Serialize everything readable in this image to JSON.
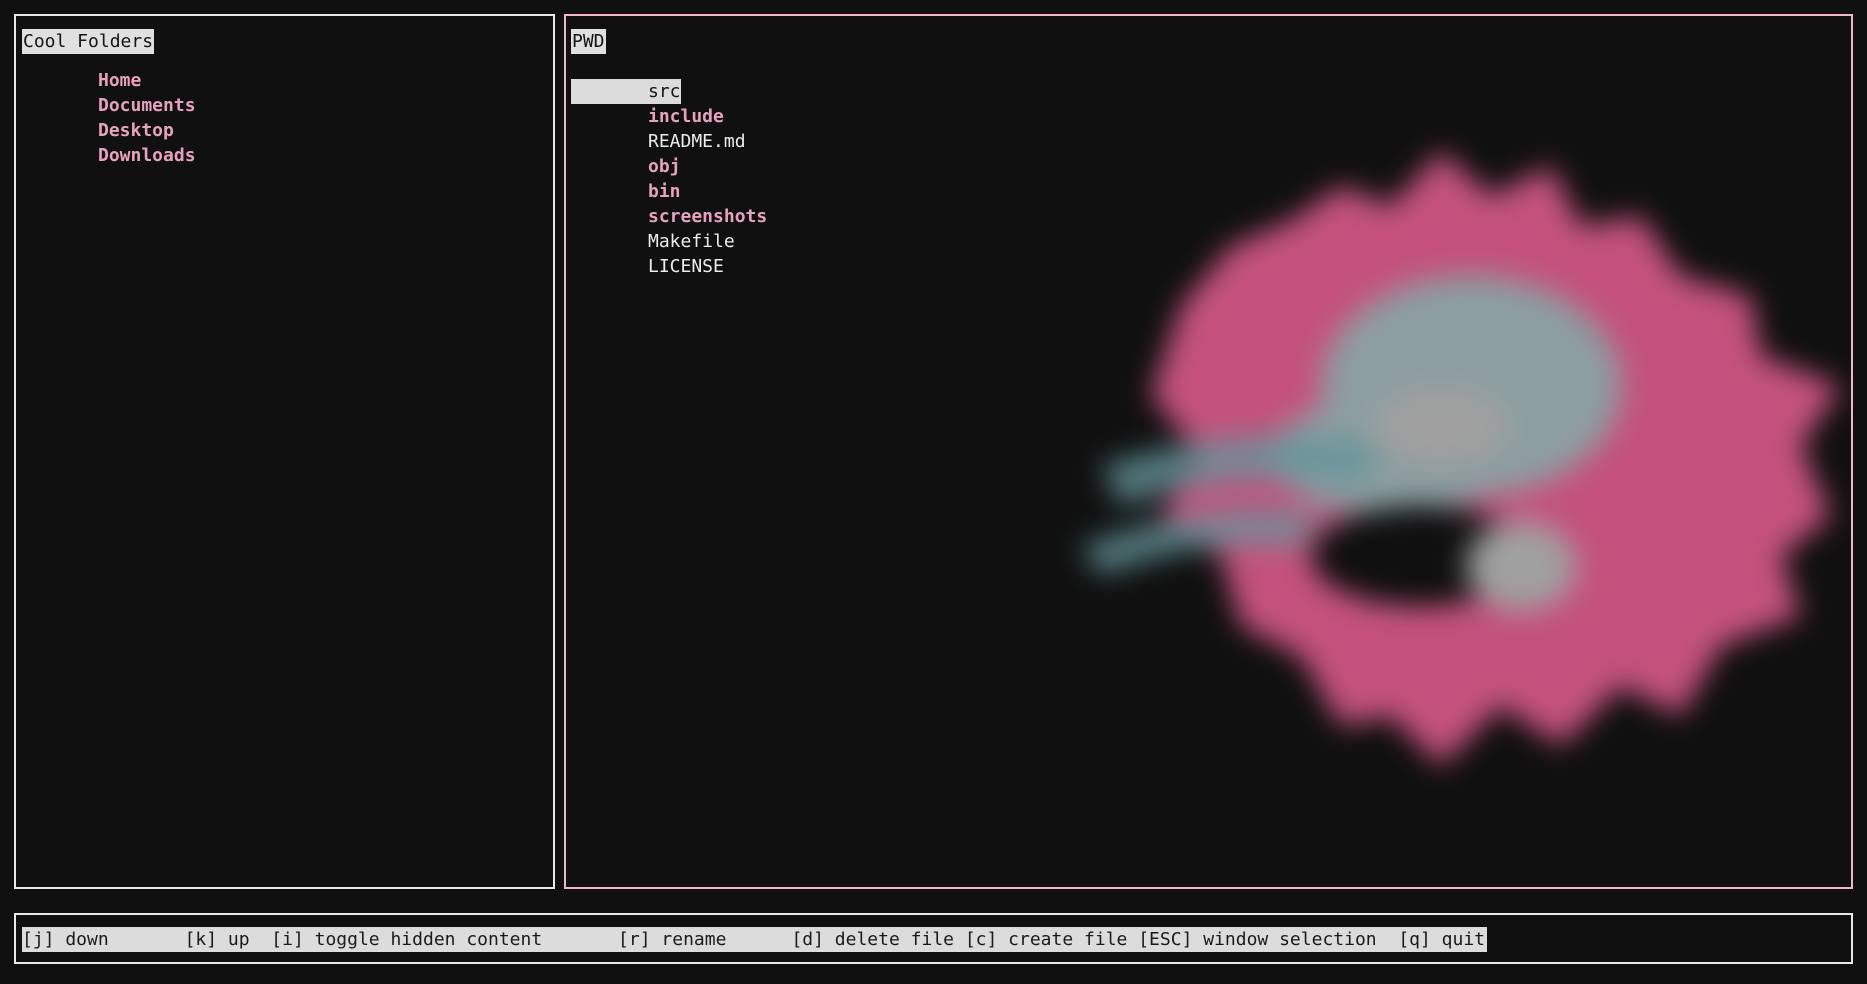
{
  "left_pane": {
    "title": "Cool Folders",
    "items": [
      "Home",
      "Documents",
      "Desktop",
      "Downloads"
    ]
  },
  "right_pane": {
    "title": "PWD",
    "entries": [
      {
        "name": "src",
        "type": "dir",
        "selected": true
      },
      {
        "name": "include",
        "type": "dir"
      },
      {
        "name": "README.md",
        "type": "file"
      },
      {
        "name": "obj",
        "type": "dir"
      },
      {
        "name": "bin",
        "type": "dir"
      },
      {
        "name": "screenshots",
        "type": "dir"
      },
      {
        "name": "Makefile",
        "type": "file"
      },
      {
        "name": "LICENSE",
        "type": "file"
      }
    ]
  },
  "shortcuts": {
    "down": "[j] down       ",
    "up": "[k] up  ",
    "toggle_hidden": "[i] toggle hidden content       ",
    "rename": "[r] rename      ",
    "delete": "[d] delete file ",
    "create": "[c] create file ",
    "window_selection": "[ESC] window selection  ",
    "quit": "[q] quit"
  },
  "colors": {
    "background": "#101010",
    "directory": "#e8a2bd",
    "file": "#ececec",
    "highlight": "#dcdcdc",
    "right_border": "#f0b6c8"
  },
  "preview": {
    "icon": "blurred-image-preview"
  }
}
